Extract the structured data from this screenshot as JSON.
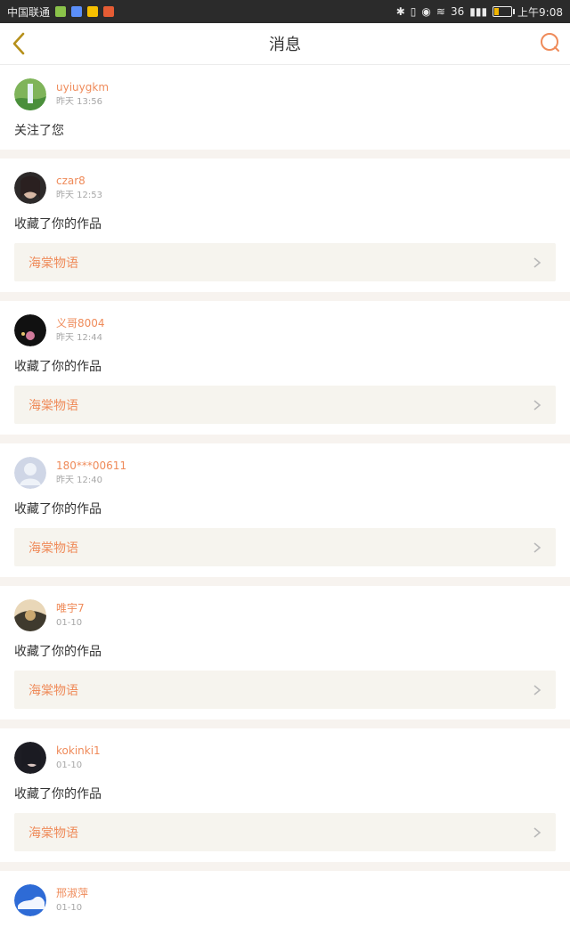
{
  "status": {
    "carrier": "中国联通",
    "net": "36",
    "time": "上午9:08"
  },
  "header": {
    "title": "消息"
  },
  "colors": {
    "accent": "#ef8b5a"
  },
  "messages": [
    {
      "user": "uyiuygkm",
      "time": "昨天 13:56",
      "action": "关注了您",
      "work": null
    },
    {
      "user": "czar8",
      "time": "昨天 12:53",
      "action": "收藏了你的作品",
      "work": "海棠物语"
    },
    {
      "user": "义哥8004",
      "time": "昨天 12:44",
      "action": "收藏了你的作品",
      "work": "海棠物语"
    },
    {
      "user": "180***00611",
      "time": "昨天 12:40",
      "action": "收藏了你的作品",
      "work": "海棠物语"
    },
    {
      "user": "唯宇7",
      "time": "01-10",
      "action": "收藏了你的作品",
      "work": "海棠物语"
    },
    {
      "user": "kokinki1",
      "time": "01-10",
      "action": "收藏了你的作品",
      "work": "海棠物语"
    },
    {
      "user": "邢淑萍",
      "time": "01-10",
      "action": "",
      "work": null
    }
  ]
}
